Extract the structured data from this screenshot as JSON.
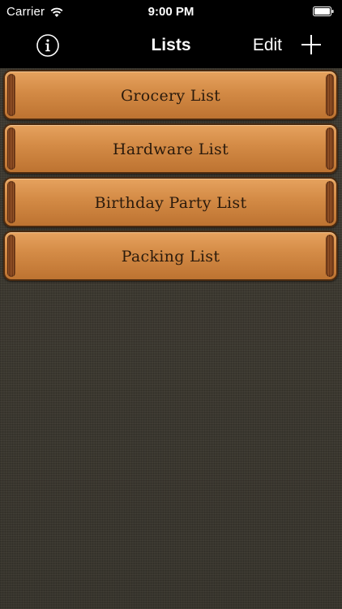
{
  "status_bar": {
    "carrier": "Carrier",
    "time": "9:00 PM",
    "wifi_icon": "wifi-icon",
    "battery_icon": "battery-icon"
  },
  "nav": {
    "title": "Lists",
    "edit_label": "Edit",
    "info_icon": "info-icon",
    "add_icon": "plus-icon"
  },
  "lists": [
    {
      "label": "Grocery List"
    },
    {
      "label": "Hardware List"
    },
    {
      "label": "Birthday Party List"
    },
    {
      "label": "Packing List"
    }
  ],
  "colors": {
    "bar_background": "#000000",
    "row_orange": "#d38a45",
    "row_border": "#4a2a10",
    "background_linen": "#3b382f"
  }
}
